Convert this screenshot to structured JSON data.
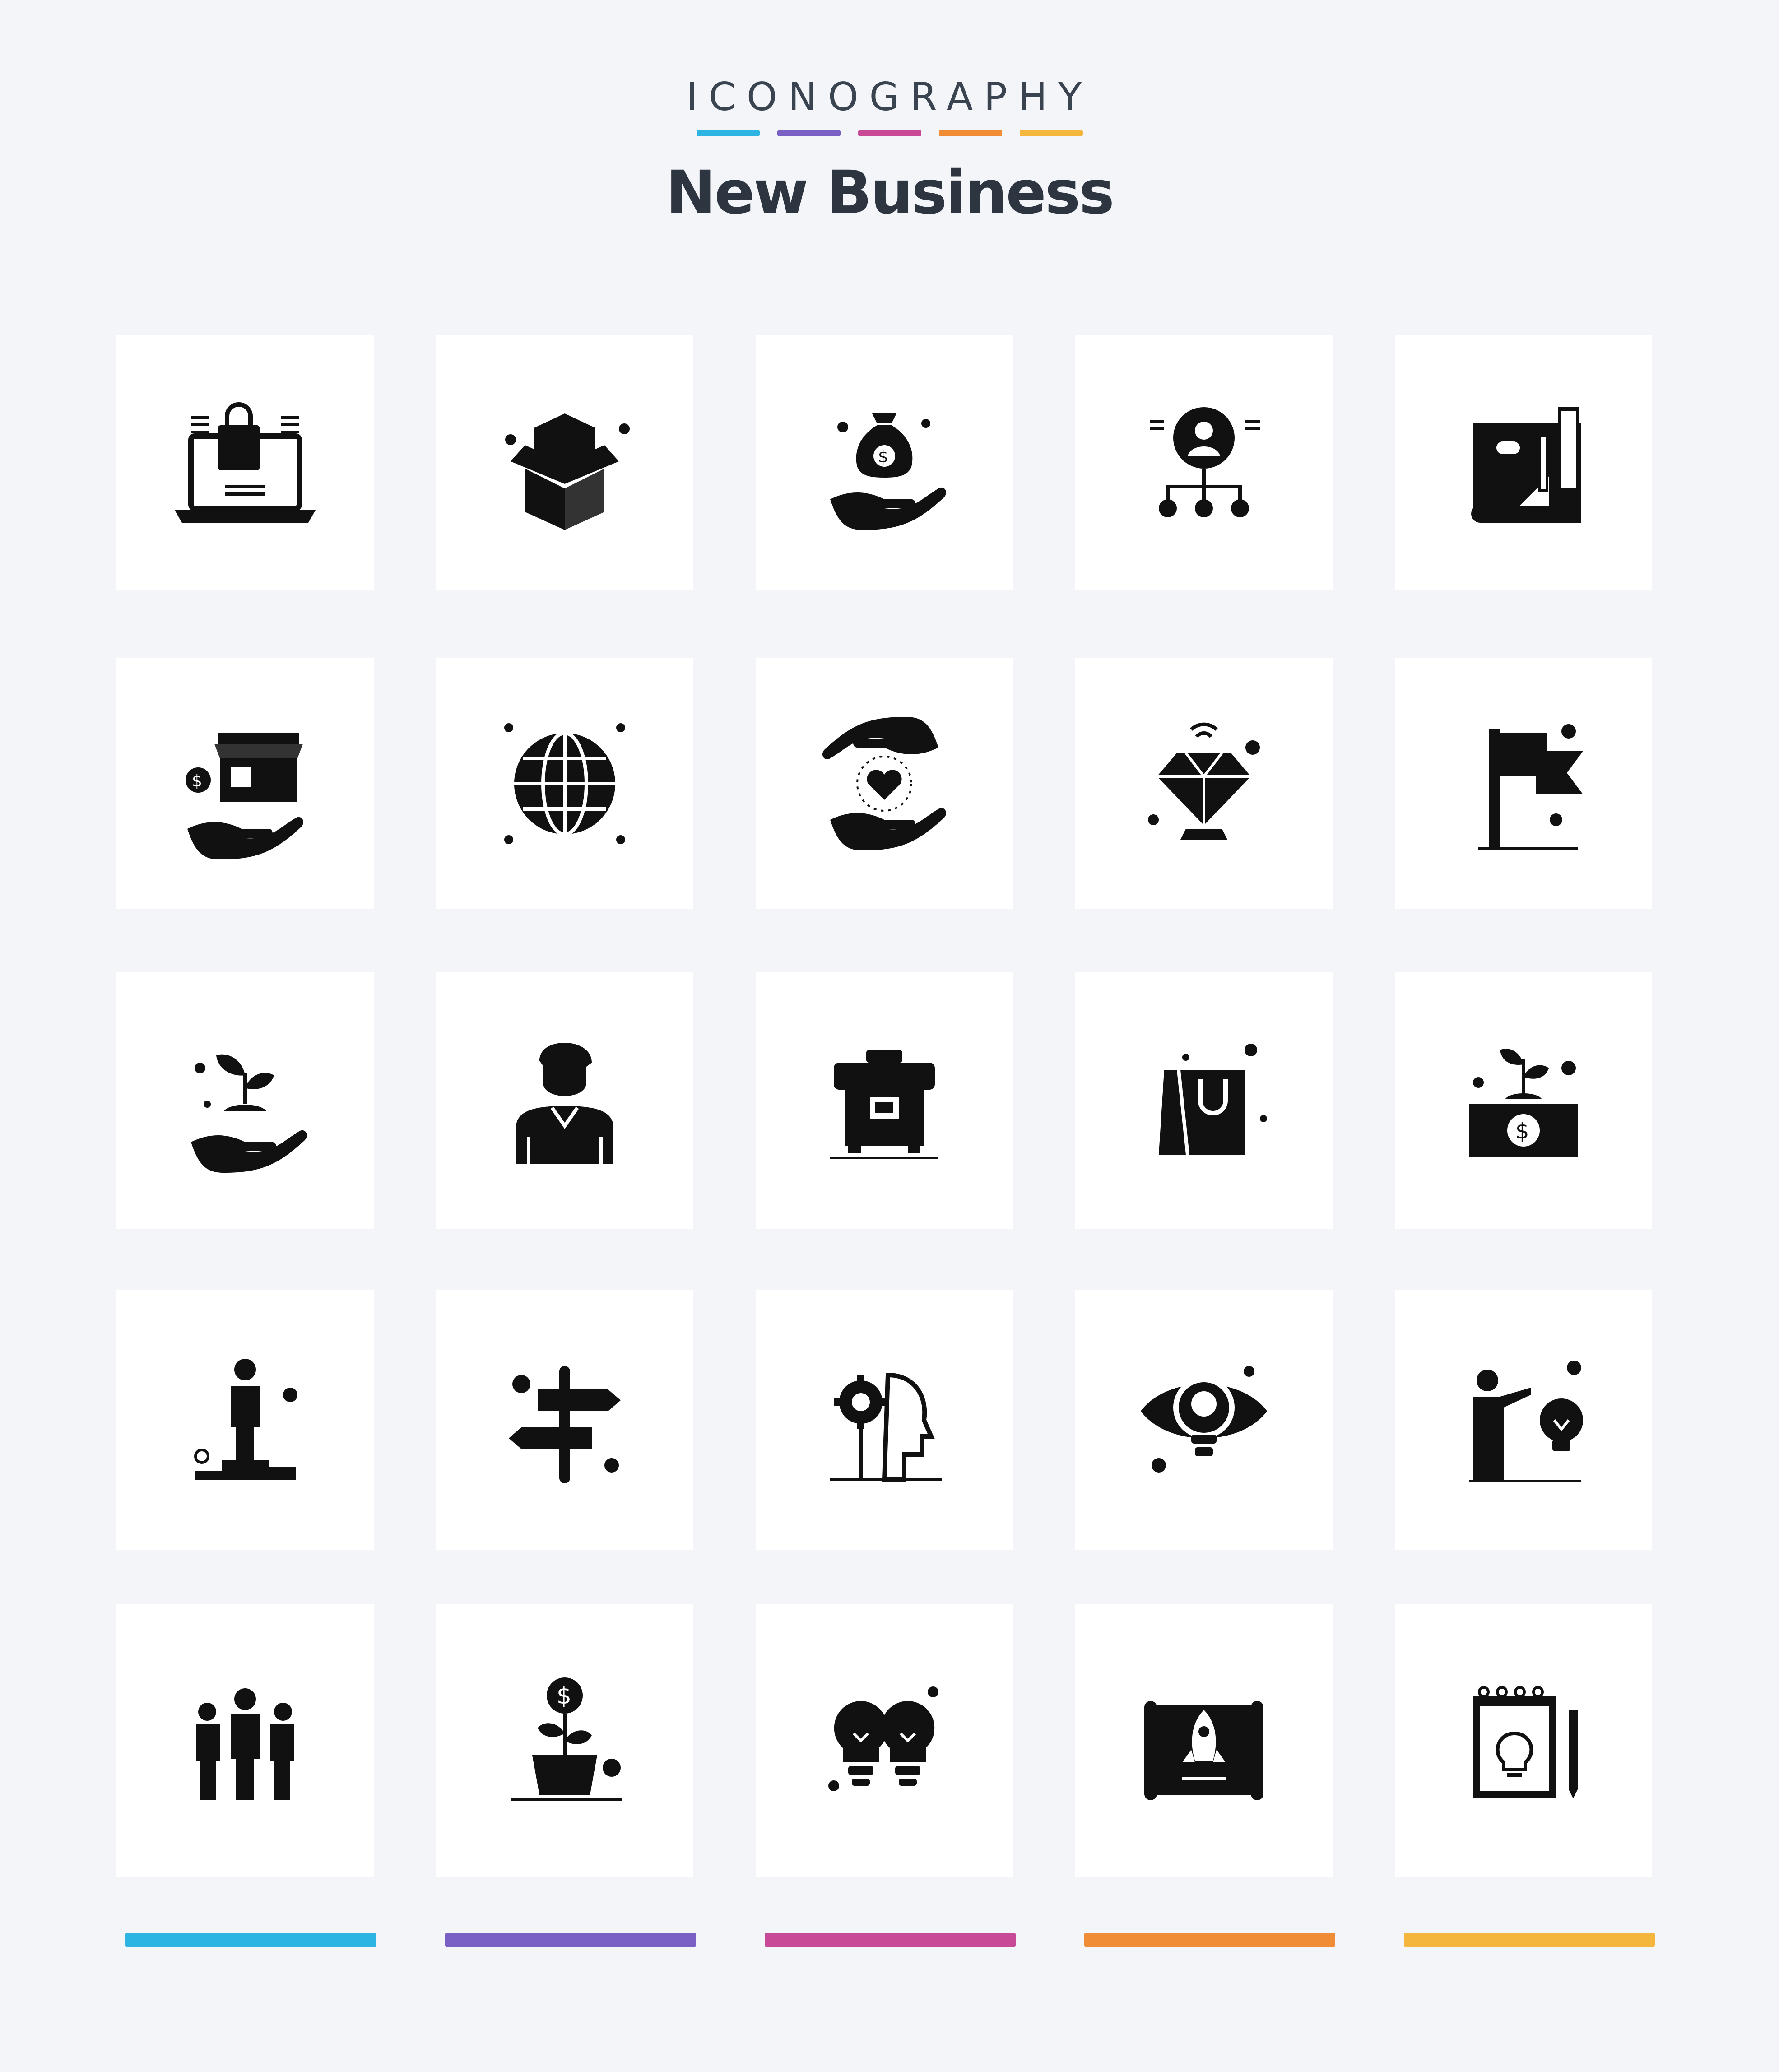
{
  "header": {
    "brand": "ICONOGRAPHY",
    "title": "New Business",
    "accent_colors": [
      "#2db4e2",
      "#7a5fc4",
      "#c84a97",
      "#f08c35",
      "#f4b63d"
    ]
  },
  "icons": [
    [
      "laptop-shopping-bag-icon",
      "open-box-icon",
      "money-bag-hand-icon",
      "user-network-icon",
      "blueprint-tools-icon"
    ],
    [
      "shop-hand-dollar-icon",
      "globe-icon",
      "hands-heart-icon",
      "diamond-icon",
      "flag-icon"
    ],
    [
      "plant-hand-icon",
      "businessman-avatar-icon",
      "briefcase-icon",
      "shopping-bag-icon",
      "plant-money-icon"
    ],
    [
      "person-podium-icon",
      "signpost-icon",
      "head-gear-icon",
      "eye-bulb-icon",
      "presenter-bulb-icon"
    ],
    [
      "team-group-icon",
      "money-plant-pot-icon",
      "double-bulb-icon",
      "rocket-blueprint-icon",
      "notepad-bulb-icon"
    ]
  ],
  "footer_colors": [
    "#2db4e2",
    "#7a5fc4",
    "#c84a97",
    "#f08c35",
    "#f4b63d"
  ]
}
